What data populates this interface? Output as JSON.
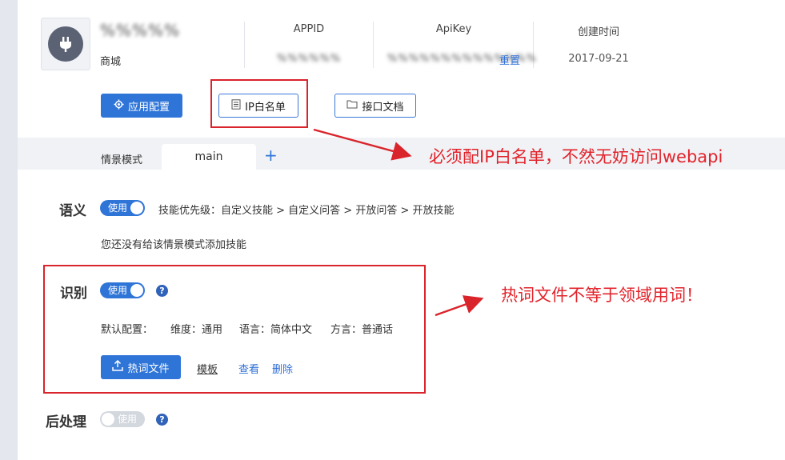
{
  "app": {
    "name_blurred": "%%%%%",
    "subtitle": "商城",
    "columns": [
      {
        "label": "APPID",
        "value_blurred": "%%%%%%"
      },
      {
        "label": "ApiKey",
        "value_blurred": "%%%%%%%%%%%%%%"
      },
      {
        "label": "创建时间",
        "value": "2017-09-21"
      }
    ],
    "reset_label": "重置"
  },
  "toolbar": {
    "app_config_label": "应用配置",
    "ip_whitelist_label": "IP白名单",
    "api_doc_label": "接口文档"
  },
  "tabs": {
    "scene_label": "情景模式",
    "active_tab": "main",
    "add_label": "+"
  },
  "annotations": {
    "ip_note": "必须配IP白名单，不然无妨访问webapi",
    "hotword_note": "热词文件不等于领域用词！"
  },
  "semantic": {
    "title": "语义",
    "toggle_label": "使用",
    "priority_text": "技能优先级：自定义技能 > 自定义问答 > 开放问答 > 开放技能",
    "empty_text": "您还没有给该情景模式添加技能"
  },
  "recognition": {
    "title": "识别",
    "toggle_label": "使用",
    "help": "?",
    "default_config": "默认配置：",
    "dimension": "维度：通用",
    "language": "语言：简体中文",
    "dialect": "方言：普通话",
    "hotword_button": "热词文件",
    "template_link": "模板",
    "view_link": "查看",
    "delete_link": "删除"
  },
  "postprocess": {
    "title": "后处理",
    "toggle_label": "使用",
    "help": "?"
  },
  "colors": {
    "accent": "#2f75d8",
    "annotation_red": "#e2232b"
  }
}
